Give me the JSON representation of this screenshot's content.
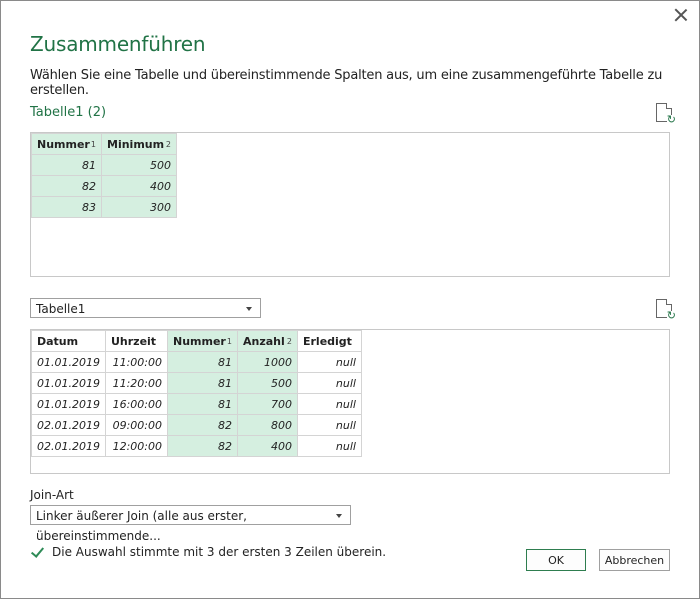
{
  "dialog": {
    "title": "Zusammenführen",
    "description": "Wählen Sie eine Tabelle und übereinstimmende Spalten aus, um eine zusammengeführte Tabelle zu erstellen."
  },
  "first_table": {
    "label": "Tabelle1 (2)",
    "columns": [
      {
        "name": "Nummer",
        "index": "1"
      },
      {
        "name": "Minimum",
        "index": "2"
      }
    ],
    "rows": [
      [
        "81",
        "500"
      ],
      [
        "82",
        "400"
      ],
      [
        "83",
        "300"
      ]
    ]
  },
  "second_table": {
    "selected": "Tabelle1",
    "columns": [
      {
        "name": "Datum",
        "index": ""
      },
      {
        "name": "Uhrzeit",
        "index": ""
      },
      {
        "name": "Nummer",
        "index": "1"
      },
      {
        "name": "Anzahl",
        "index": "2"
      },
      {
        "name": "Erledigt",
        "index": ""
      }
    ],
    "rows": [
      [
        "01.01.2019",
        "11:00:00",
        "81",
        "1000",
        "null"
      ],
      [
        "01.01.2019",
        "11:20:00",
        "81",
        "500",
        "null"
      ],
      [
        "01.01.2019",
        "16:00:00",
        "81",
        "700",
        "null"
      ],
      [
        "02.01.2019",
        "09:00:00",
        "82",
        "800",
        "null"
      ],
      [
        "02.01.2019",
        "12:00:00",
        "82",
        "400",
        "null"
      ]
    ]
  },
  "join": {
    "label": "Join-Art",
    "selected": "Linker äußerer Join (alle aus erster, übereinstimmende..."
  },
  "status": {
    "message": "Die Auswahl stimmte mit 3 der ersten 3 Zeilen überein."
  },
  "buttons": {
    "ok": "OK",
    "cancel": "Abbrechen"
  },
  "colors": {
    "accent": "#217346",
    "selected_column": "#d5efe0"
  }
}
